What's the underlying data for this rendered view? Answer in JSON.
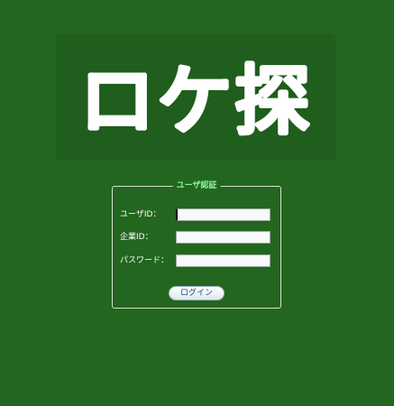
{
  "logo": {
    "text": "ロケ探"
  },
  "auth": {
    "legend": "ユーザ認証",
    "fields": [
      {
        "label": "ユーザID：",
        "value": ""
      },
      {
        "label": "企業ID：",
        "value": ""
      },
      {
        "label": "パスワード：",
        "value": ""
      }
    ],
    "login_label": "ログイン"
  },
  "colors": {
    "background": "#23661f",
    "logo_panel": "#1f5e1c",
    "legend_text": "#8ff39a",
    "button_text": "#1b4f86"
  }
}
